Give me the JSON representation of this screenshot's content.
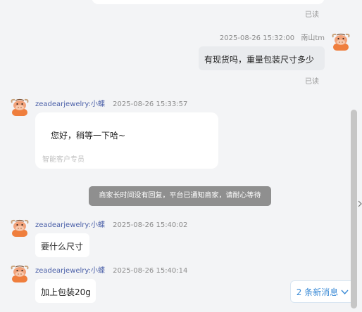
{
  "messages": {
    "prev_status": "已读",
    "m1": {
      "time": "2025-08-26 15:32:00",
      "sender": "南山tm",
      "text": "有现货吗，重量包装尺寸多少",
      "status": "已读"
    },
    "m2": {
      "sender": "zeadearjewelry:小蝶",
      "time": "2025-08-26 15:33:57",
      "text": "您好，稍等一下哈~",
      "sub": "智能客户专员"
    },
    "notice": "商家长时间没有回复，平台已通知商家，请耐心等待",
    "m3": {
      "sender": "zeadearjewelry:小蝶",
      "time": "2025-08-26 15:40:02",
      "text": "要什么尺寸"
    },
    "m4": {
      "sender": "zeadearjewelry:小蝶",
      "time": "2025-08-26 15:40:14",
      "text": "加上包装20g"
    }
  },
  "new_messages_label": "2 条新消息",
  "icons": {
    "avatar": "cartoon-ox-avatar-icon",
    "new_messages": "chevron-down-icon",
    "side_handle": "chevron-right-icon"
  },
  "colors": {
    "background": "#f3f4f6",
    "sender_name": "#4a5fa8",
    "notice_bg": "#8f8f8f",
    "new_message_text": "#3b8bd6",
    "avatar_orange": "#ef7e3d"
  }
}
